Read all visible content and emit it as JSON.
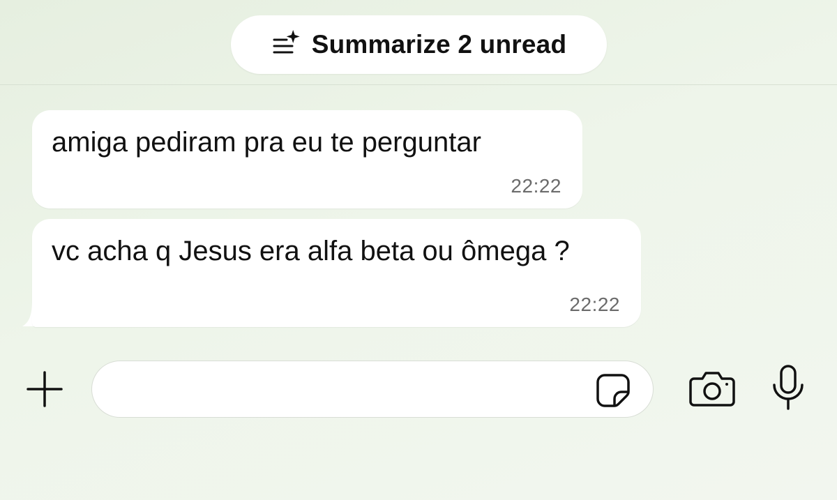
{
  "summary_button": {
    "label": "Summarize 2 unread",
    "icon": "summarize-sparkle-icon"
  },
  "messages": [
    {
      "text": "amiga pediram pra eu te perguntar",
      "time": "22:22"
    },
    {
      "text": "vc acha q Jesus era alfa beta ou ômega ?",
      "time": "22:22"
    }
  ],
  "composer": {
    "input_value": "",
    "input_placeholder": "",
    "icons": {
      "attach": "plus-icon",
      "sticker": "sticker-icon",
      "camera": "camera-icon",
      "microphone": "microphone-icon"
    }
  },
  "colors": {
    "background": "#e9f1e4",
    "bubble": "#ffffff",
    "text": "#111111",
    "timestamp": "#6b6b6b"
  }
}
